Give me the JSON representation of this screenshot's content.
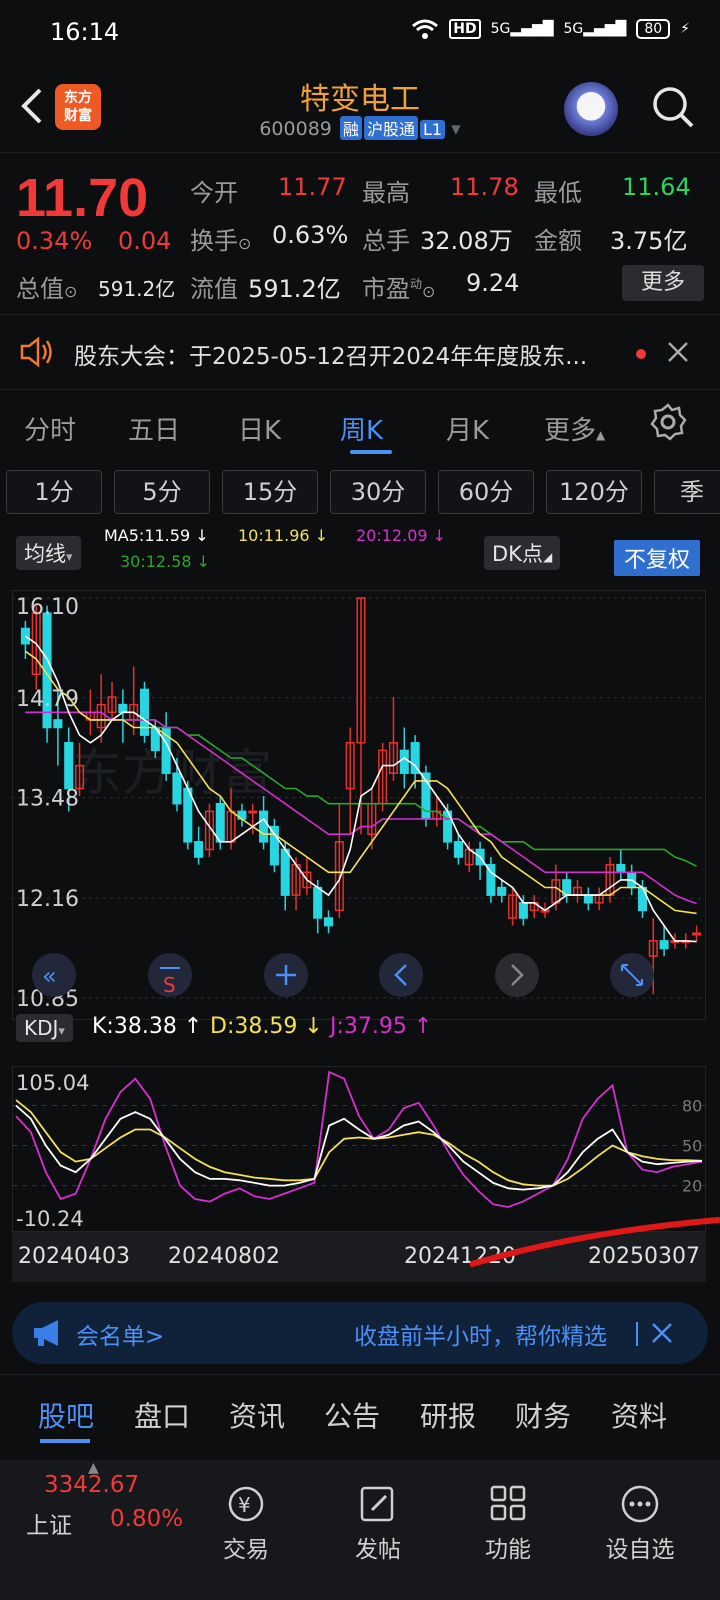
{
  "status_bar": {
    "time": "16:14",
    "hd": "HD",
    "net1": "5G",
    "net2": "5G",
    "battery": "80"
  },
  "header": {
    "brand_line1": "东方",
    "brand_line2": "财富",
    "title": "特变电工",
    "code": "600089",
    "tags": [
      "融",
      "沪股通",
      "L1"
    ]
  },
  "quote": {
    "price": "11.70",
    "change_pct": "0.34%",
    "change": "0.04",
    "open_label": "今开",
    "open": "11.77",
    "high_label": "最高",
    "high": "11.78",
    "low_label": "最低",
    "low": "11.64",
    "turnover_label": "换手",
    "turnover": "0.63%",
    "volume_label": "总手",
    "volume": "32.08万",
    "amount_label": "金额",
    "amount": "3.75亿",
    "mktcap_label": "总值",
    "mktcap": "591.2亿",
    "float_label": "流值",
    "float": "591.2亿",
    "pe_label": "市盈",
    "pe_sup": "动",
    "pe": "9.24",
    "more": "更多"
  },
  "notice": {
    "text": "股东大会：于2025-05-12召开2024年年度股东..."
  },
  "period_tabs": [
    "分时",
    "五日",
    "日K",
    "周K",
    "月K",
    "更多"
  ],
  "period_active": "周K",
  "minute_buttons": [
    "1分",
    "5分",
    "15分",
    "30分",
    "60分",
    "120分",
    "季"
  ],
  "ma": {
    "selector": "均线",
    "ma5": "MA5:11.59 ↓",
    "ma10": "10:11.96 ↓",
    "ma20": "20:12.09 ↓",
    "ma30": "30:12.58 ↓",
    "dk": "DK点",
    "adjust": "不复权",
    "colors": {
      "ma5": "#ffffff",
      "ma10": "#f5e05a",
      "ma20": "#d62fd0",
      "ma30": "#2ba52b"
    }
  },
  "kdj": {
    "selector": "KDJ",
    "k": "K:38.38 ↑",
    "d": "D:38.59 ↓",
    "j": "J:37.95 ↑",
    "axis_top": "105.04",
    "axis_bottom": "-10.24",
    "levels": [
      "80",
      "50",
      "20"
    ]
  },
  "dates": [
    "20240403",
    "20240802",
    "20241220",
    "20250307"
  ],
  "chart_data": {
    "type": "candlestick",
    "y_ticks": [
      "16.10",
      "14.79",
      "13.48",
      "12.16",
      "10.85"
    ],
    "ylim": [
      10.85,
      16.1
    ],
    "candles": [
      {
        "o": 15.7,
        "c": 15.5,
        "h": 15.8,
        "l": 15.3
      },
      {
        "o": 15.1,
        "c": 15.9,
        "h": 16.0,
        "l": 14.9
      },
      {
        "o": 15.9,
        "c": 14.4,
        "h": 16.0,
        "l": 14.2
      },
      {
        "o": 14.5,
        "c": 14.4,
        "h": 14.9,
        "l": 13.9
      },
      {
        "o": 14.2,
        "c": 13.6,
        "h": 14.4,
        "l": 13.3
      },
      {
        "o": 13.6,
        "c": 13.9,
        "h": 14.2,
        "l": 13.5
      },
      {
        "o": 14.5,
        "c": 14.6,
        "h": 14.9,
        "l": 14.3
      },
      {
        "o": 14.4,
        "c": 14.7,
        "h": 15.1,
        "l": 14.2
      },
      {
        "o": 14.6,
        "c": 14.8,
        "h": 15.0,
        "l": 14.5
      },
      {
        "o": 14.7,
        "c": 14.6,
        "h": 14.9,
        "l": 14.2
      },
      {
        "o": 14.5,
        "c": 14.7,
        "h": 15.2,
        "l": 14.3
      },
      {
        "o": 14.9,
        "c": 14.3,
        "h": 15.0,
        "l": 14.2
      },
      {
        "o": 14.4,
        "c": 14.1,
        "h": 14.5,
        "l": 14.0
      },
      {
        "o": 14.4,
        "c": 13.8,
        "h": 14.6,
        "l": 13.7
      },
      {
        "o": 13.8,
        "c": 13.4,
        "h": 14.0,
        "l": 13.3
      },
      {
        "o": 13.6,
        "c": 12.9,
        "h": 13.7,
        "l": 12.8
      },
      {
        "o": 12.9,
        "c": 12.7,
        "h": 13.1,
        "l": 12.6
      },
      {
        "o": 12.8,
        "c": 13.3,
        "h": 13.4,
        "l": 12.7
      },
      {
        "o": 13.4,
        "c": 12.9,
        "h": 13.5,
        "l": 12.8
      },
      {
        "o": 12.9,
        "c": 13.3,
        "h": 13.6,
        "l": 12.8
      },
      {
        "o": 13.3,
        "c": 13.2,
        "h": 13.4,
        "l": 13.1
      },
      {
        "o": 13.3,
        "c": 13.3,
        "h": 13.4,
        "l": 13.0
      },
      {
        "o": 13.3,
        "c": 12.9,
        "h": 13.5,
        "l": 12.8
      },
      {
        "o": 13.1,
        "c": 12.6,
        "h": 13.2,
        "l": 12.5
      },
      {
        "o": 12.8,
        "c": 12.2,
        "h": 12.9,
        "l": 12.0
      },
      {
        "o": 12.2,
        "c": 12.6,
        "h": 12.7,
        "l": 12.0
      },
      {
        "o": 12.3,
        "c": 12.5,
        "h": 12.7,
        "l": 12.2
      },
      {
        "o": 12.3,
        "c": 11.9,
        "h": 12.4,
        "l": 11.7
      },
      {
        "o": 11.9,
        "c": 11.8,
        "h": 12.0,
        "l": 11.7
      },
      {
        "o": 12.0,
        "c": 12.9,
        "h": 13.4,
        "l": 11.9
      },
      {
        "o": 13.6,
        "c": 14.2,
        "h": 14.4,
        "l": 13.0
      },
      {
        "o": 14.2,
        "c": 16.1,
        "h": 16.1,
        "l": 13.0
      },
      {
        "o": 13.0,
        "c": 13.4,
        "h": 13.6,
        "l": 12.8
      },
      {
        "o": 13.4,
        "c": 14.1,
        "h": 14.2,
        "l": 13.3
      },
      {
        "o": 13.8,
        "c": 14.2,
        "h": 14.8,
        "l": 13.7
      },
      {
        "o": 14.1,
        "c": 13.8,
        "h": 14.4,
        "l": 13.6
      },
      {
        "o": 14.2,
        "c": 13.8,
        "h": 14.3,
        "l": 13.6
      },
      {
        "o": 13.8,
        "c": 13.2,
        "h": 13.9,
        "l": 13.1
      },
      {
        "o": 13.2,
        "c": 13.3,
        "h": 13.5,
        "l": 13.1
      },
      {
        "o": 13.3,
        "c": 12.9,
        "h": 13.4,
        "l": 12.8
      },
      {
        "o": 12.9,
        "c": 12.7,
        "h": 13.0,
        "l": 12.6
      },
      {
        "o": 12.6,
        "c": 12.8,
        "h": 12.9,
        "l": 12.5
      },
      {
        "o": 12.8,
        "c": 12.6,
        "h": 12.9,
        "l": 12.4
      },
      {
        "o": 12.6,
        "c": 12.2,
        "h": 12.7,
        "l": 12.1
      },
      {
        "o": 12.3,
        "c": 12.2,
        "h": 12.4,
        "l": 12.1
      },
      {
        "o": 11.9,
        "c": 12.2,
        "h": 12.3,
        "l": 11.8
      },
      {
        "o": 12.1,
        "c": 11.9,
        "h": 12.2,
        "l": 11.8
      },
      {
        "o": 12.0,
        "c": 12.1,
        "h": 12.2,
        "l": 11.9
      },
      {
        "o": 12.0,
        "c": 12.0,
        "h": 12.1,
        "l": 11.9
      },
      {
        "o": 12.1,
        "c": 12.4,
        "h": 12.6,
        "l": 12.0
      },
      {
        "o": 12.4,
        "c": 12.2,
        "h": 12.5,
        "l": 12.1
      },
      {
        "o": 12.2,
        "c": 12.3,
        "h": 12.4,
        "l": 12.1
      },
      {
        "o": 12.2,
        "c": 12.1,
        "h": 12.3,
        "l": 12.0
      },
      {
        "o": 12.1,
        "c": 12.2,
        "h": 12.3,
        "l": 12.0
      },
      {
        "o": 12.2,
        "c": 12.6,
        "h": 12.7,
        "l": 12.1
      },
      {
        "o": 12.6,
        "c": 12.5,
        "h": 12.8,
        "l": 12.4
      },
      {
        "o": 12.5,
        "c": 12.3,
        "h": 12.6,
        "l": 12.2
      },
      {
        "o": 12.3,
        "c": 12.0,
        "h": 12.4,
        "l": 11.9
      },
      {
        "o": 11.4,
        "c": 11.6,
        "h": 11.9,
        "l": 10.9
      },
      {
        "o": 11.6,
        "c": 11.5,
        "h": 11.8,
        "l": 11.4
      },
      {
        "o": 11.6,
        "c": 11.6,
        "h": 11.7,
        "l": 11.5
      },
      {
        "o": 11.6,
        "c": 11.6,
        "h": 11.7,
        "l": 11.5
      },
      {
        "o": 11.7,
        "c": 11.7,
        "h": 11.8,
        "l": 11.6
      }
    ],
    "ma5": [
      15.6,
      15.5,
      15.3,
      15.0,
      14.6,
      14.3,
      14.2,
      14.3,
      14.5,
      14.6,
      14.6,
      14.5,
      14.4,
      14.2,
      13.9,
      13.6,
      13.3,
      13.1,
      12.9,
      12.9,
      13.0,
      13.1,
      13.2,
      13.0,
      12.8,
      12.6,
      12.4,
      12.3,
      12.2,
      12.4,
      12.8,
      13.5,
      13.6,
      13.9,
      13.9,
      14.0,
      13.9,
      13.7,
      13.5,
      13.3,
      13.0,
      12.8,
      12.7,
      12.5,
      12.4,
      12.3,
      12.1,
      12.1,
      12.0,
      12.1,
      12.2,
      12.2,
      12.2,
      12.2,
      12.3,
      12.4,
      12.4,
      12.3,
      12.0,
      11.8,
      11.6,
      11.6,
      11.59
    ],
    "ma10": [
      15.4,
      15.3,
      15.1,
      14.9,
      14.8,
      14.6,
      14.5,
      14.5,
      14.5,
      14.5,
      14.4,
      14.4,
      14.4,
      14.3,
      14.2,
      14.0,
      13.8,
      13.6,
      13.5,
      13.3,
      13.2,
      13.1,
      13.0,
      13.0,
      12.9,
      12.8,
      12.7,
      12.6,
      12.5,
      12.5,
      12.5,
      12.7,
      12.9,
      13.1,
      13.3,
      13.5,
      13.7,
      13.7,
      13.7,
      13.6,
      13.4,
      13.2,
      13.0,
      12.9,
      12.7,
      12.6,
      12.5,
      12.4,
      12.3,
      12.3,
      12.2,
      12.2,
      12.2,
      12.2,
      12.2,
      12.3,
      12.3,
      12.3,
      12.2,
      12.1,
      12.0,
      11.98,
      11.96
    ],
    "ma20": [
      14.6,
      14.6,
      14.6,
      14.6,
      14.6,
      14.6,
      14.6,
      14.6,
      14.5,
      14.5,
      14.5,
      14.5,
      14.5,
      14.4,
      14.4,
      14.3,
      14.2,
      14.1,
      14.0,
      13.9,
      13.8,
      13.7,
      13.6,
      13.5,
      13.4,
      13.3,
      13.2,
      13.1,
      13.0,
      13.0,
      13.0,
      13.1,
      13.1,
      13.2,
      13.2,
      13.2,
      13.2,
      13.2,
      13.2,
      13.2,
      13.2,
      13.1,
      13.0,
      13.0,
      12.9,
      12.8,
      12.7,
      12.6,
      12.5,
      12.5,
      12.5,
      12.5,
      12.5,
      12.5,
      12.5,
      12.5,
      12.5,
      12.5,
      12.4,
      12.3,
      12.2,
      12.14,
      12.09
    ],
    "ma30": [
      14.6,
      14.6,
      14.6,
      14.6,
      14.6,
      14.6,
      14.5,
      14.5,
      14.5,
      14.5,
      14.5,
      14.5,
      14.4,
      14.4,
      14.4,
      14.3,
      14.3,
      14.2,
      14.1,
      14.0,
      14.0,
      13.9,
      13.8,
      13.7,
      13.6,
      13.6,
      13.5,
      13.5,
      13.4,
      13.4,
      13.4,
      13.4,
      13.4,
      13.4,
      13.4,
      13.4,
      13.4,
      13.3,
      13.3,
      13.2,
      13.2,
      13.1,
      13.1,
      13.0,
      12.9,
      12.9,
      12.9,
      12.8,
      12.8,
      12.8,
      12.8,
      12.8,
      12.8,
      12.8,
      12.8,
      12.8,
      12.8,
      12.8,
      12.8,
      12.8,
      12.7,
      12.65,
      12.58
    ]
  },
  "kdj_data": {
    "ylim": [
      -10.24,
      105.04
    ],
    "k": [
      80,
      70,
      50,
      35,
      30,
      40,
      55,
      70,
      75,
      70,
      55,
      40,
      30,
      25,
      25,
      24,
      22,
      20,
      20,
      22,
      25,
      65,
      70,
      62,
      55,
      58,
      65,
      68,
      60,
      50,
      38,
      30,
      22,
      18,
      17,
      18,
      20,
      30,
      45,
      55,
      62,
      45,
      38,
      36,
      37,
      38,
      38.38
    ],
    "d": [
      84,
      75,
      60,
      45,
      38,
      40,
      48,
      56,
      62,
      62,
      56,
      48,
      40,
      34,
      30,
      28,
      26,
      25,
      24,
      24,
      25,
      45,
      55,
      56,
      55,
      56,
      58,
      60,
      58,
      52,
      44,
      38,
      30,
      24,
      21,
      20,
      20,
      25,
      33,
      42,
      50,
      45,
      42,
      40,
      39,
      39,
      38.59
    ],
    "j": [
      72,
      60,
      30,
      10,
      14,
      40,
      70,
      90,
      100,
      85,
      50,
      20,
      10,
      8,
      14,
      18,
      12,
      10,
      14,
      18,
      22,
      105,
      100,
      72,
      55,
      62,
      78,
      82,
      65,
      45,
      28,
      16,
      6,
      4,
      8,
      14,
      20,
      40,
      70,
      85,
      95,
      45,
      32,
      30,
      34,
      36,
      37.95
    ]
  },
  "banner": {
    "left": "会名单>",
    "right": "收盘前半小时，帮你精选"
  },
  "bottom_tabs": [
    "股吧",
    "盘口",
    "资讯",
    "公告",
    "研报",
    "财务",
    "资料"
  ],
  "bottom_nav": {
    "index_name": "上证",
    "index_value": "3342.67",
    "index_change": "0.80%",
    "items": [
      "交易",
      "发帖",
      "功能",
      "设自选"
    ]
  }
}
